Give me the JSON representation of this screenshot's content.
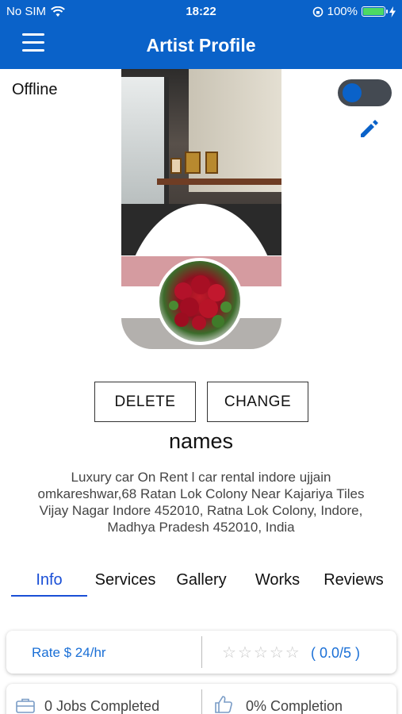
{
  "status_bar": {
    "carrier": "No SIM",
    "time": "18:22",
    "battery": "100%"
  },
  "header": {
    "title": "Artist Profile"
  },
  "status_toggle": {
    "label": "Offline"
  },
  "actions": {
    "delete_label": "DELETE",
    "change_label": "CHANGE"
  },
  "profile": {
    "name": "names",
    "address": "Luxury car On Rent l car rental indore ujjain omkareshwar,68 Ratan Lok Colony Near Kajariya Tiles Vijay Nagar Indore 452010, Ratna Lok Colony, Indore, Madhya Pradesh 452010, India"
  },
  "tabs": [
    {
      "label": "Info",
      "active": true
    },
    {
      "label": "Services",
      "active": false
    },
    {
      "label": "Gallery",
      "active": false
    },
    {
      "label": "Works",
      "active": false
    },
    {
      "label": "Reviews",
      "active": false
    }
  ],
  "stats": {
    "rate": "Rate $ 24/hr",
    "rating": "( 0.0/5 )",
    "stars": 0,
    "jobs": "0 Jobs Completed",
    "completion": "0% Completion"
  },
  "colors": {
    "brand": "#0a62c9",
    "accent": "#1a4fd6",
    "battery": "#4cd964"
  }
}
